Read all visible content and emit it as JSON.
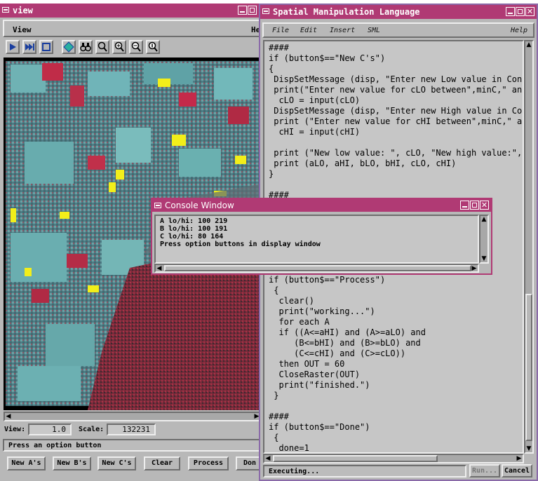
{
  "view_window": {
    "title": "view",
    "menu": {
      "view": "View",
      "help": "He"
    },
    "toolbar": [
      "play-icon",
      "skip-forward-icon",
      "stop-icon",
      "pan-icon",
      "binoculars-icon",
      "zoom-select-icon",
      "zoom-in-icon",
      "zoom-out-icon",
      "zoom-1x-icon"
    ],
    "view_label": "View:",
    "view_value": "1.0",
    "scale_label": "Scale:",
    "scale_value": "132231",
    "status": "Press an option button",
    "buttons": [
      "New A's",
      "New B's",
      "New C's",
      "Clear",
      "Process",
      "Don"
    ]
  },
  "sml_window": {
    "title": "Spatial Manipulation Language",
    "menu": [
      "File",
      "Edit",
      "Insert",
      "SML"
    ],
    "help": "Help",
    "code_top": "####\nif (button$==\"New C's\")\n{\n DispSetMessage (disp, \"Enter new Low value in Conso\n print(\"Enter new value for cLO between\",minC,\" and\"\n  cLO = input(cLO)\n DispSetMessage (disp, \"Enter new High value in Cons\n print (\"Enter new value for cHI between\",minC,\" and\n  cHI = input(cHI)\n\n print (\"New low value: \", cLO, \"New high value:\", c\n print (aLO, aHI, bLO, bHI, cLO, cHI)\n}\n\n####",
    "code_bottom": "if (button$==\"Process\")\n {\n  clear()\n  print(\"working...\")\n  for each A\n  if ((A<=aHI) and (A>=aLO) and\n     (B<=bHI) and (B>=bLO) and\n     (C<=cHI) and (C>=cLO))\n  then OUT = 60\n  CloseRaster(OUT)\n  print(\"finished.\")\n }\n\n####\nif (button$==\"Done\")\n {\n  done=1",
    "status": "Executing...",
    "run_label": "Run...",
    "cancel_label": "Cancel"
  },
  "console_window": {
    "title": "Console Window",
    "text": "A lo/hi: 100 219\nB lo/hi: 100 191\nC lo/hi: 80 164\nPress option buttons in display window"
  },
  "colors": {
    "titlebar": "#b03a74",
    "window_bg": "#b8b8b8",
    "image_red": "#b0304a",
    "image_cyan": "#5a9a9e",
    "image_yellow": "#f2ee1a"
  }
}
